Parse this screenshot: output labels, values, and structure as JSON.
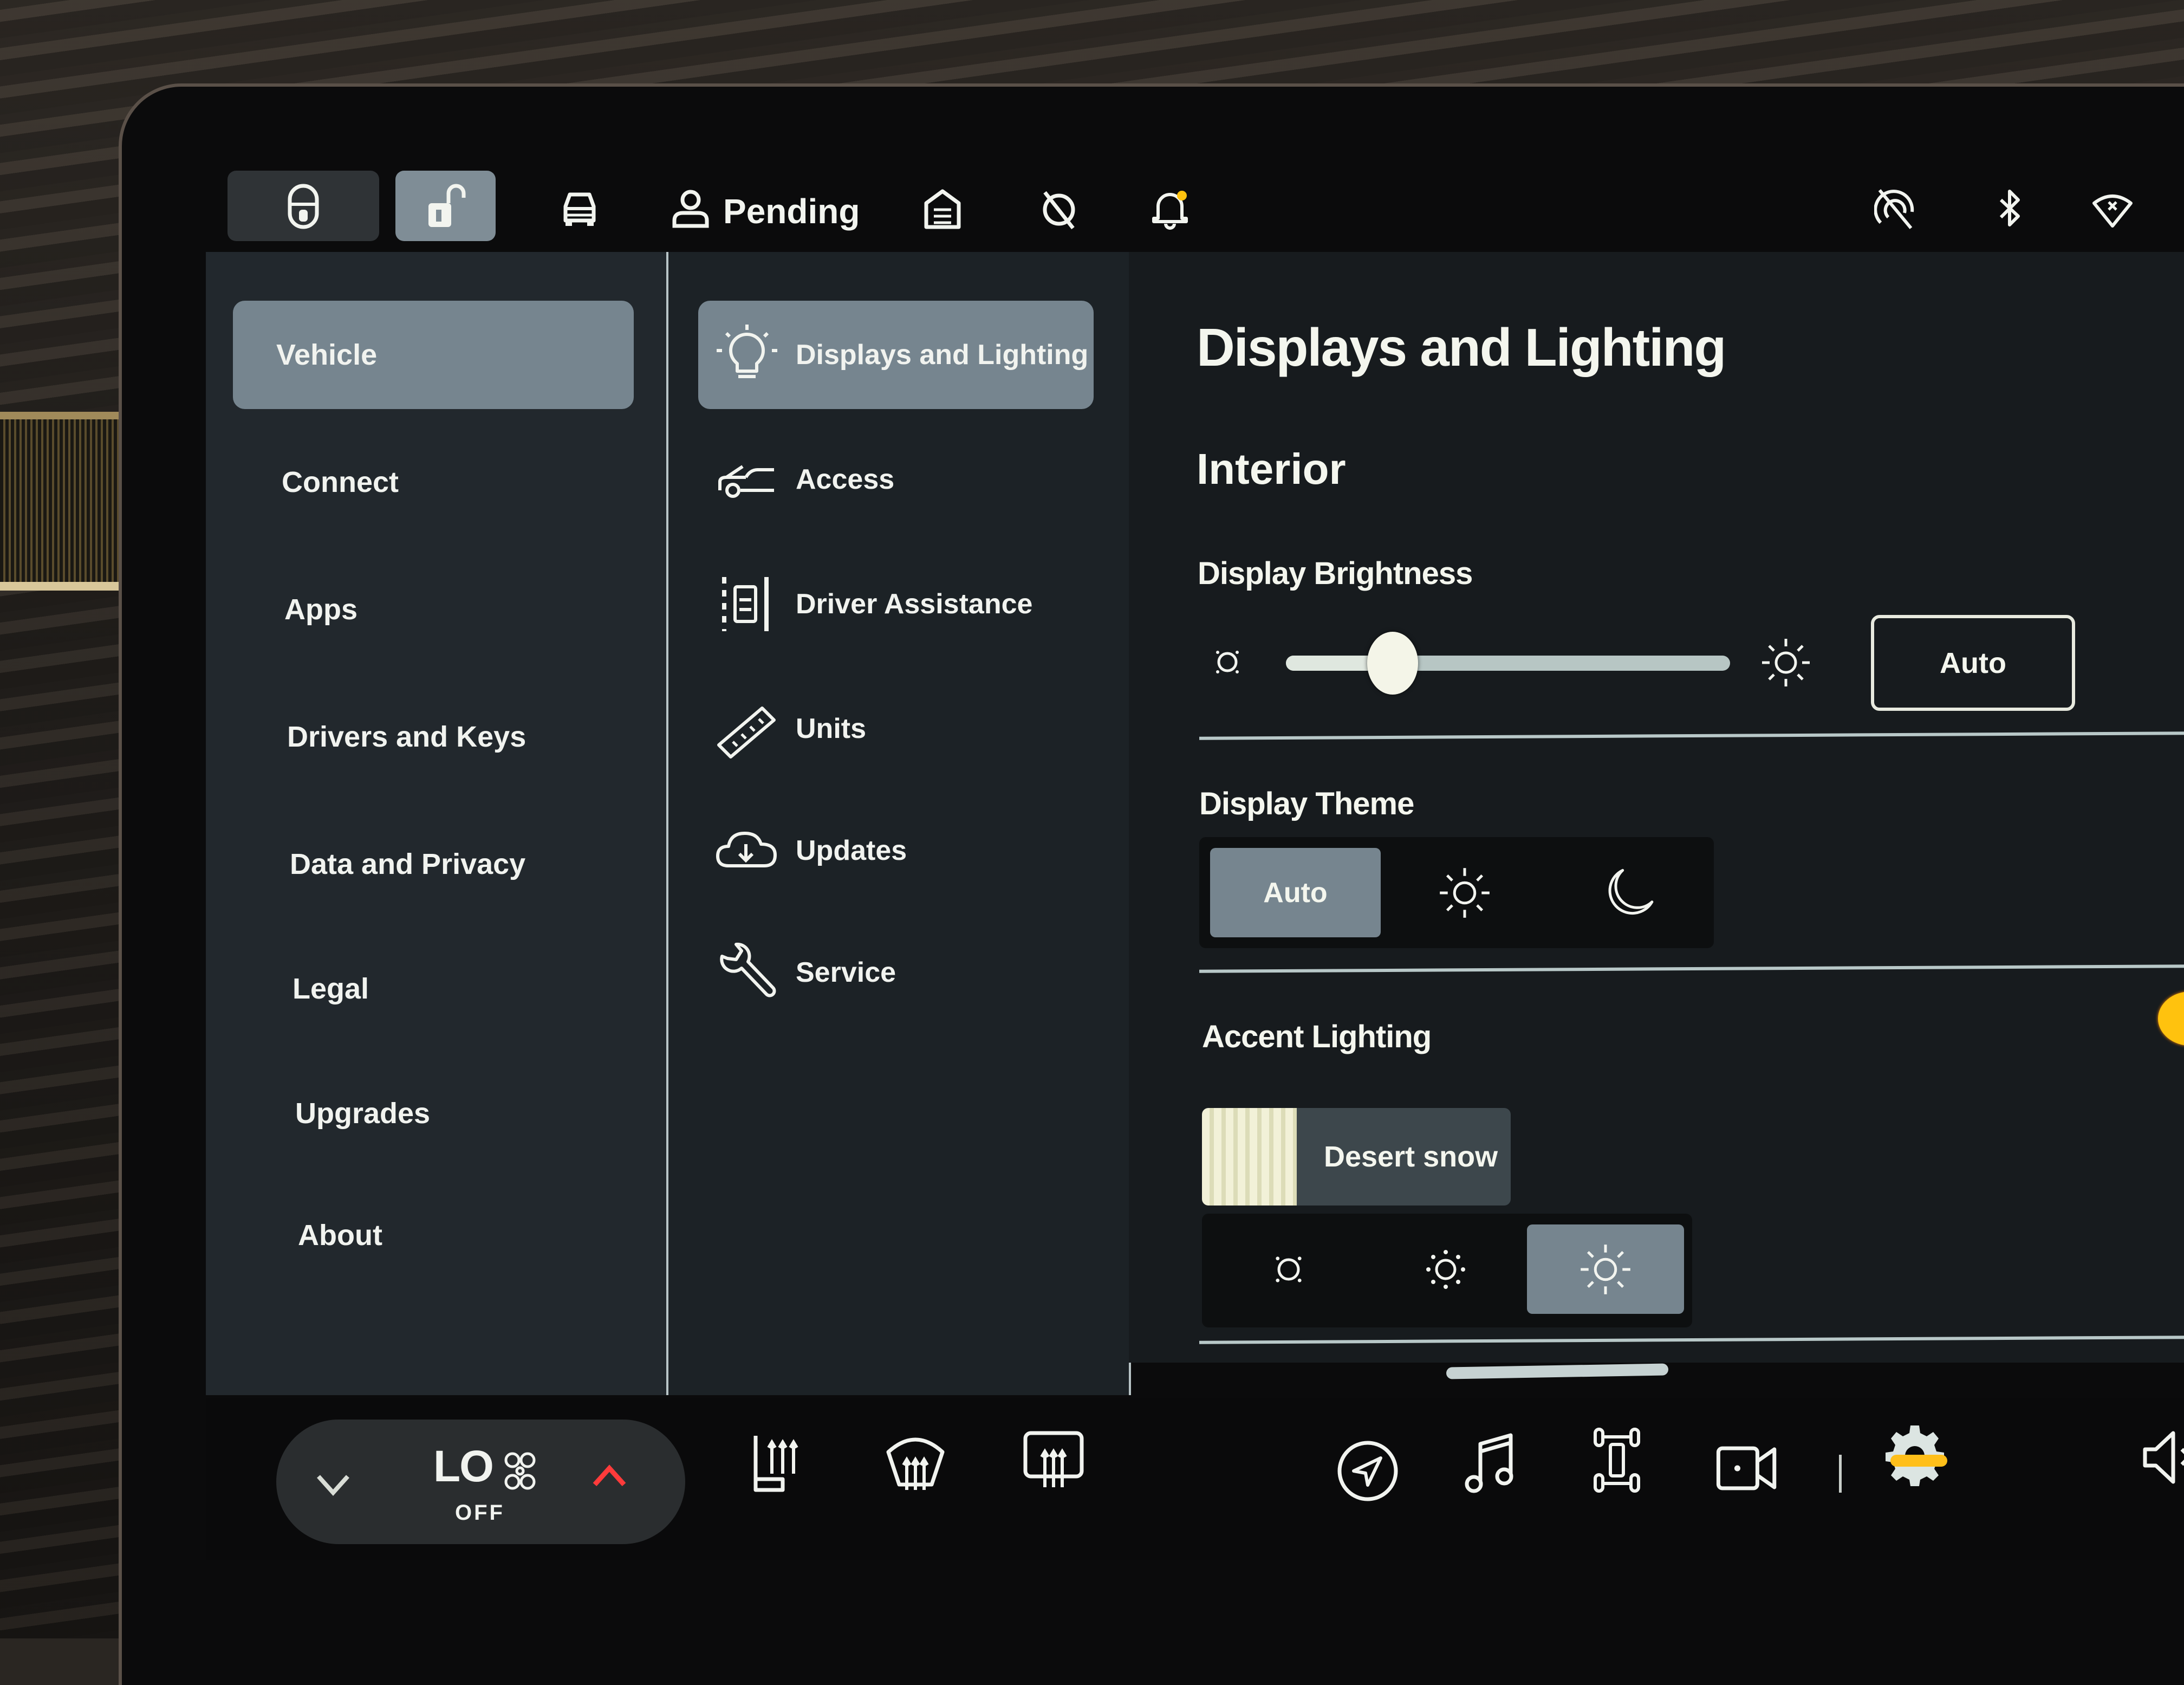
{
  "status_bar": {
    "lock_button": {
      "icon": "lock-icon"
    },
    "unlock_button": {
      "icon": "unlock-icon",
      "active": true
    },
    "vehicle_icon": "car-icon",
    "profile": {
      "icon": "person-icon",
      "label": "Pending"
    },
    "garage_icon": "homelink-garage-icon",
    "sentry_icon": "sentry-off-icon",
    "notification_icon": "bell-icon",
    "right_icons": [
      "connectivity-off-icon",
      "bluetooth-icon",
      "wifi-disconnected-icon"
    ],
    "notification_dot_color": "#ffc20e"
  },
  "settings_nav": {
    "items": [
      {
        "label": "Vehicle",
        "active": true
      },
      {
        "label": "Connect"
      },
      {
        "label": "Apps"
      },
      {
        "label": "Drivers and Keys"
      },
      {
        "label": "Data and Privacy"
      },
      {
        "label": "Legal"
      },
      {
        "label": "Upgrades"
      },
      {
        "label": "About"
      }
    ]
  },
  "sub_nav": {
    "items": [
      {
        "label": "Displays and Lighting",
        "icon": "lightbulb-icon",
        "active": true
      },
      {
        "label": "Access",
        "icon": "car-hood-open-icon"
      },
      {
        "label": "Driver Assistance",
        "icon": "lane-assist-icon"
      },
      {
        "label": "Units",
        "icon": "ruler-icon"
      },
      {
        "label": "Updates",
        "icon": "cloud-download-icon"
      },
      {
        "label": "Service",
        "icon": "wrench-icon"
      }
    ]
  },
  "content": {
    "title": "Displays and Lighting",
    "section": "Interior",
    "display_brightness": {
      "label": "Display Brightness",
      "value_percent": 24,
      "auto_button": "Auto"
    },
    "display_theme": {
      "label": "Display Theme",
      "options": [
        {
          "label": "Auto",
          "active": true
        },
        {
          "icon": "sun-icon"
        },
        {
          "icon": "moon-icon"
        }
      ]
    },
    "accent_lighting": {
      "label": "Accent Lighting",
      "enabled": true,
      "toggle_color": "#ffc20e",
      "color_name": "Desert snow",
      "brightness_options": [
        {
          "icon": "brightness-low-icon"
        },
        {
          "icon": "brightness-medium-icon"
        },
        {
          "icon": "brightness-high-icon",
          "active": true
        }
      ]
    }
  },
  "bottom_bar": {
    "climate": {
      "temperature": "LO",
      "fan_status": "OFF",
      "down_icon": "chevron-down-icon",
      "up_icon": "chevron-up-icon",
      "up_color": "#ff3b3b"
    },
    "climate_icons": [
      "seat-heater-icon",
      "front-defrost-icon",
      "rear-defrost-icon"
    ],
    "apps": [
      "navigation-icon",
      "music-icon",
      "toybox-icon",
      "camera-icon",
      "settings-gear-icon"
    ],
    "active_app": "settings-gear-icon",
    "active_color": "#ffbf1a",
    "volume_icon": "volume-muted-icon"
  }
}
